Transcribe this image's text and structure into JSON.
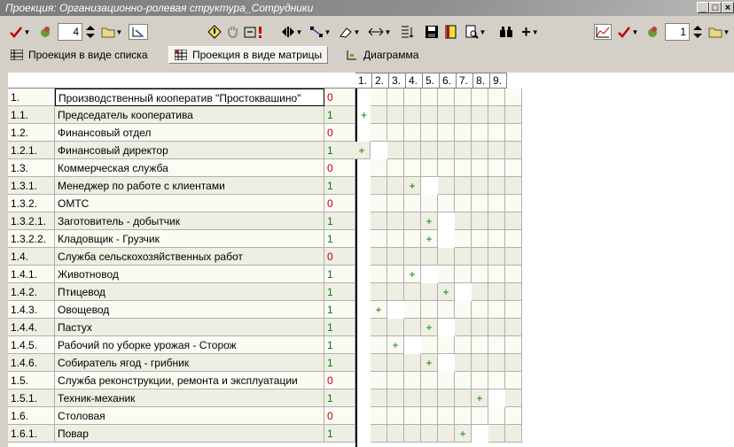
{
  "window": {
    "title": "Проекция: Организационно-ролевая структура_Сотрудники",
    "min": "_",
    "max": "□",
    "close": "×"
  },
  "toolbar": {
    "spin_left": "4",
    "spin_right": "1"
  },
  "tabs": [
    {
      "label": "Проекция в виде списка",
      "active": false
    },
    {
      "label": "Проекция в виде матрицы",
      "active": true
    },
    {
      "label": "Диаграмма",
      "active": false
    }
  ],
  "matrix": {
    "columns": [
      "1.",
      "2.",
      "3.",
      "4.",
      "5.",
      "6.",
      "7.",
      "8.",
      "9."
    ],
    "rows": [
      {
        "num": "1.",
        "name": "Производственный кооператив \"Простоквашино\"",
        "value": "0",
        "mark": null
      },
      {
        "num": "1.1.",
        "name": "Председатель кооператива",
        "value": "1",
        "mark": 0
      },
      {
        "num": "1.2.",
        "name": "Финансовый отдел",
        "value": "0",
        "mark": null
      },
      {
        "num": "1.2.1.",
        "name": "Финансовый директор",
        "value": "1",
        "mark": 1
      },
      {
        "num": "1.3.",
        "name": "Коммерческая служба",
        "value": "0",
        "mark": null
      },
      {
        "num": "1.3.1.",
        "name": "Менеджер по работе с клиентами",
        "value": "1",
        "mark": 4
      },
      {
        "num": "1.3.2.",
        "name": "ОМТС",
        "value": "0",
        "mark": null
      },
      {
        "num": "1.3.2.1.",
        "name": "Заготовитель - добытчик",
        "value": "1",
        "mark": 5
      },
      {
        "num": "1.3.2.2.",
        "name": "Кладовщик - Грузчик",
        "value": "1",
        "mark": 5
      },
      {
        "num": "1.4.",
        "name": "Служба сельскохозяйственных работ",
        "value": "0",
        "mark": null
      },
      {
        "num": "1.4.1.",
        "name": "Животновод",
        "value": "1",
        "mark": 4
      },
      {
        "num": "1.4.2.",
        "name": "Птицевод",
        "value": "1",
        "mark": 6
      },
      {
        "num": "1.4.3.",
        "name": "Овощевод",
        "value": "1",
        "mark": 2
      },
      {
        "num": "1.4.4.",
        "name": "Пастух",
        "value": "1",
        "mark": 5
      },
      {
        "num": "1.4.5.",
        "name": "Рабочий по уборке урожая - Сторож",
        "value": "1",
        "mark": 3
      },
      {
        "num": "1.4.6.",
        "name": "Собиратель ягод - грибник",
        "value": "1",
        "mark": 5
      },
      {
        "num": "1.5.",
        "name": "Служба реконструкции, ремонта и эксплуатации",
        "value": "0",
        "mark": null
      },
      {
        "num": "1.5.1.",
        "name": "Техник-механик",
        "value": "1",
        "mark": 8
      },
      {
        "num": "1.6.",
        "name": "Столовая",
        "value": "0",
        "mark": null
      },
      {
        "num": "1.6.1.",
        "name": "Повар",
        "value": "1",
        "mark": 7
      }
    ],
    "mark_symbol": "+"
  },
  "colors": {
    "value_zero": "#c00000",
    "value_one": "#008000",
    "mark": "#008000"
  }
}
